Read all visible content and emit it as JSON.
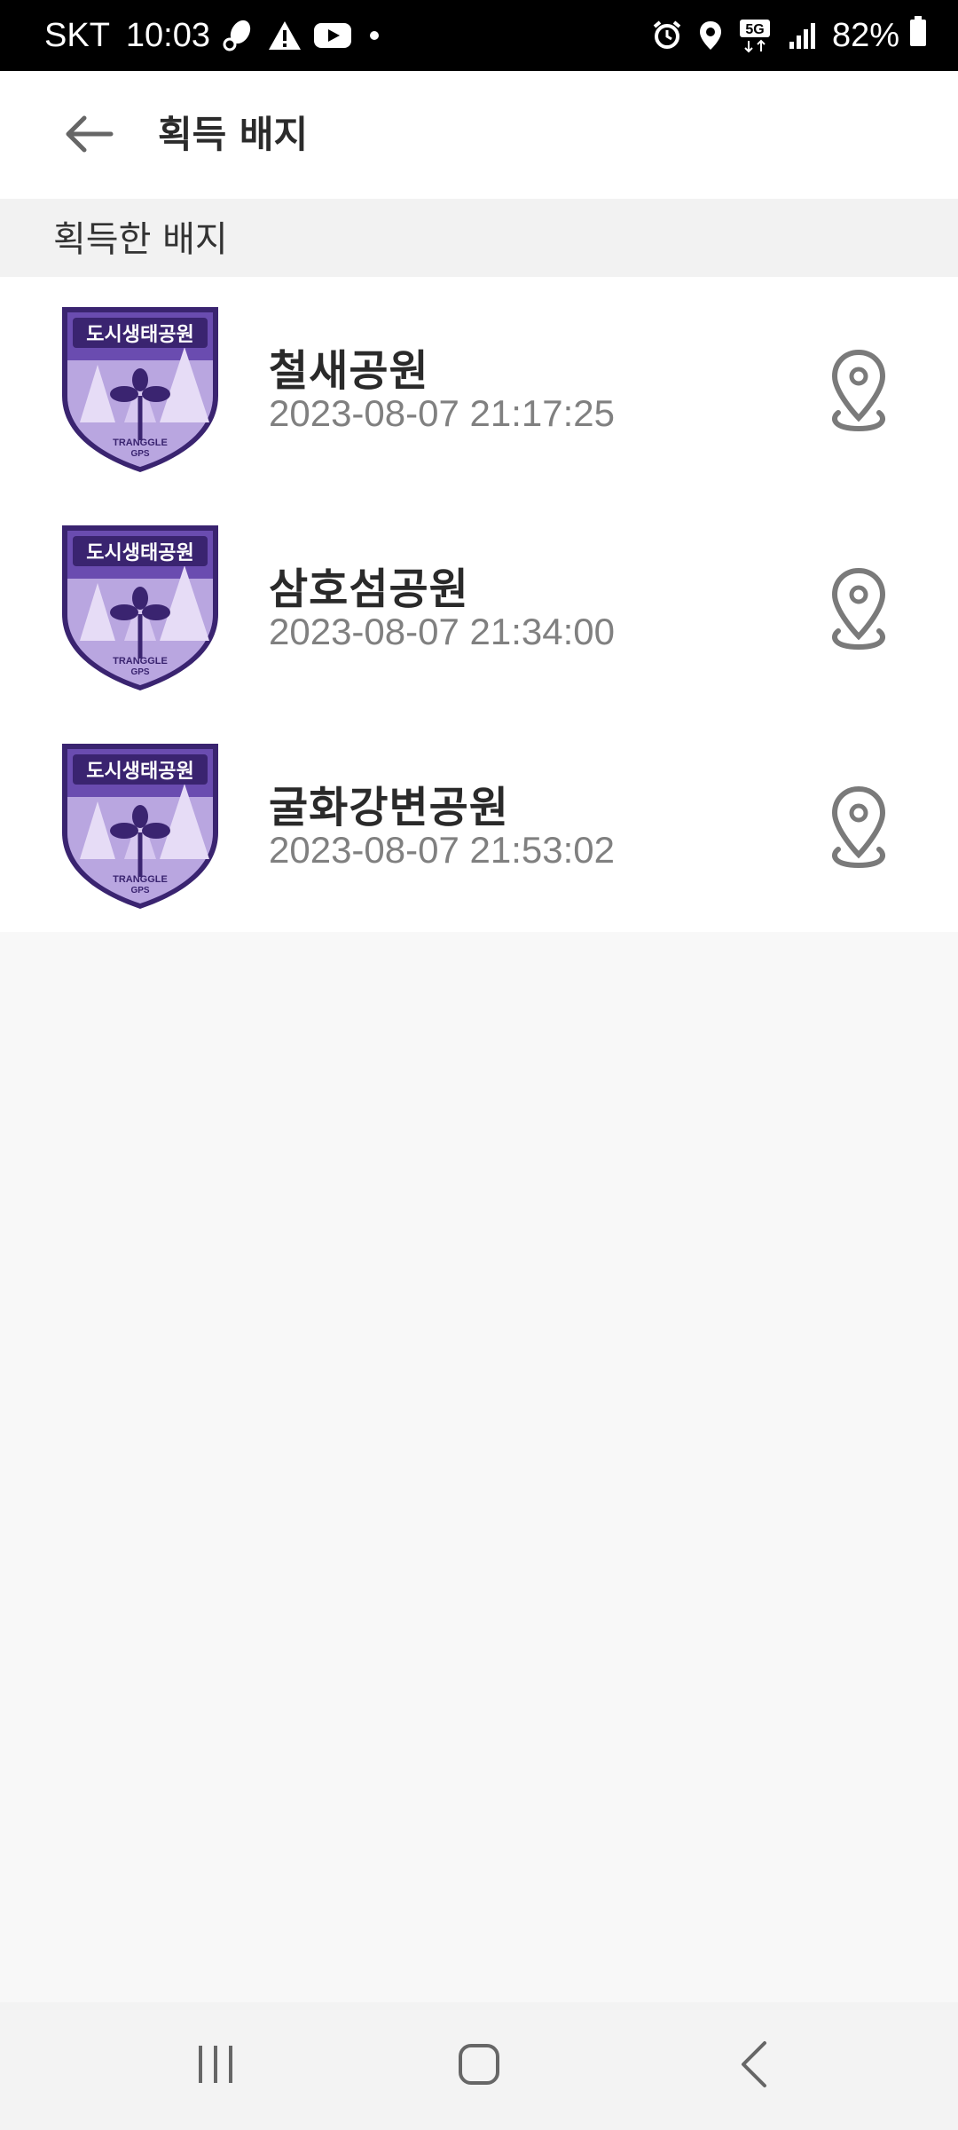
{
  "status_bar": {
    "carrier": "SKT",
    "time": "10:03",
    "network": "5G",
    "battery": "82%"
  },
  "header": {
    "title": "획득 배지"
  },
  "section": {
    "title": "획득한 배지"
  },
  "badges": [
    {
      "name": "철새공원",
      "date": "2023-08-07 21:17:25",
      "emblem_title": "도시생태공원",
      "emblem_brand": "TRANGGLE",
      "emblem_sub": "GPS"
    },
    {
      "name": "삼호섬공원",
      "date": "2023-08-07 21:34:00",
      "emblem_title": "도시생태공원",
      "emblem_brand": "TRANGGLE",
      "emblem_sub": "GPS"
    },
    {
      "name": "굴화강변공원",
      "date": "2023-08-07 21:53:02",
      "emblem_title": "도시생태공원",
      "emblem_brand": "TRANGGLE",
      "emblem_sub": "GPS"
    }
  ],
  "icons": {
    "back": "arrow-left-icon",
    "location": "map-pin-icon",
    "nav_recents": "recents-icon",
    "nav_home": "home-icon",
    "nav_back": "chevron-left-icon"
  },
  "colors": {
    "badge_purple": "#5d3f9c",
    "badge_dark": "#3a2470",
    "badge_light": "#c9b8e8",
    "icon_gray": "#7a7a7a"
  }
}
